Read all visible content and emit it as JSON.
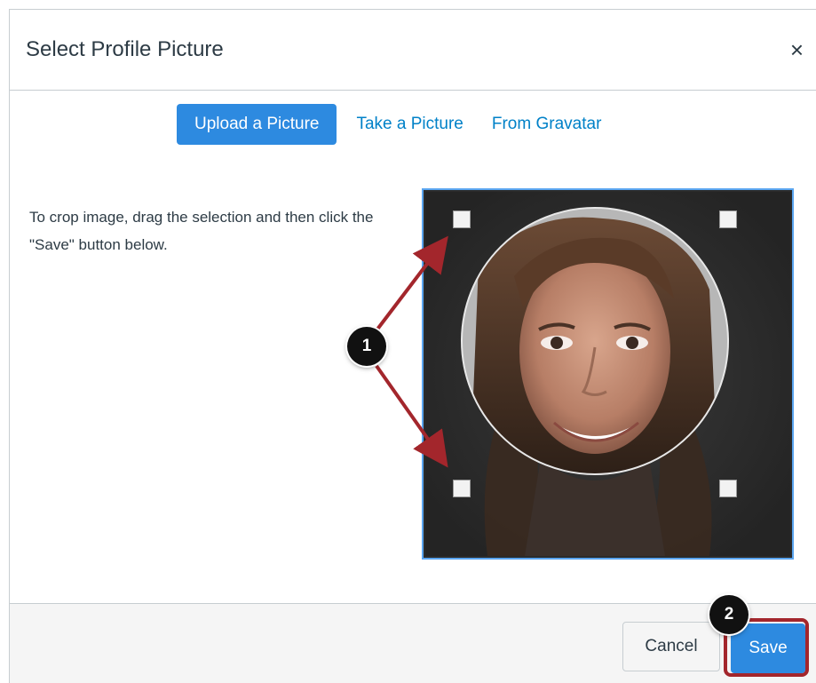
{
  "dialog": {
    "title": "Select Profile Picture",
    "close_icon": "close-icon",
    "close_glyph": "×"
  },
  "tabs": [
    {
      "label": "Upload a Picture",
      "active": true
    },
    {
      "label": "Take a Picture",
      "active": false
    },
    {
      "label": "From Gravatar",
      "active": false
    }
  ],
  "instructions": "To crop image, drag the selection and then click the \"Save\" button below.",
  "footer": {
    "cancel_label": "Cancel",
    "save_label": "Save"
  },
  "callouts": [
    {
      "number": "1"
    },
    {
      "number": "2"
    }
  ],
  "colors": {
    "accent": "#2d8ae0",
    "link": "#0081c8",
    "callout_arrow": "#a3262c",
    "crop_border": "#5aa5f0"
  }
}
